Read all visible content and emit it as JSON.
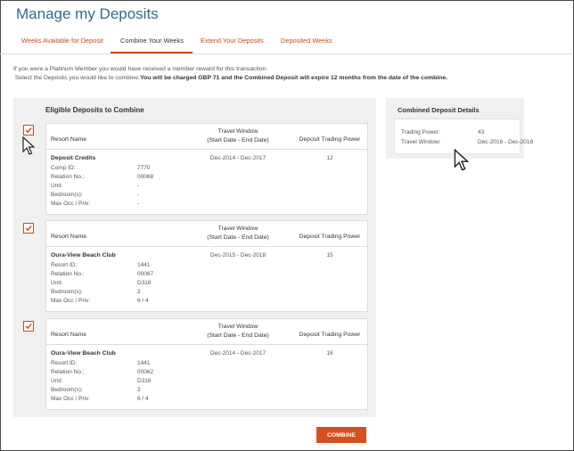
{
  "page": {
    "title": "Manage my Deposits"
  },
  "tabs": [
    {
      "label": "Weeks Available for Deposit",
      "active": false
    },
    {
      "label": "Combine Your Weeks",
      "active": true
    },
    {
      "label": "Extend Your Deposits",
      "active": false
    },
    {
      "label": "Deposited Weeks",
      "active": false
    }
  ],
  "notice": {
    "line1": "If you were a Platinum Member you would have received a member reward for this transaction.",
    "line2_prefix": "Select the Deposits you would like to combine.",
    "line2_bold": "You will be charged GBP 71 and the Combined Deposit will expire 12 months from the date of the combine."
  },
  "eligible": {
    "title": "Eligible Deposits to Combine",
    "headers": {
      "resort": "Resort Name",
      "travel_line1": "Travel Window",
      "travel_line2": "(Start Date - End Date)",
      "power": "Deposit Trading Power"
    },
    "deposits": [
      {
        "checked": true,
        "name": "Deposit Credits",
        "fields": [
          {
            "label": "Comp ID:",
            "value": "7770"
          },
          {
            "label": "Relation No.:",
            "value": "00068"
          },
          {
            "label": "Unit:",
            "value": "-"
          },
          {
            "label": "Bedroom(s):",
            "value": "-"
          },
          {
            "label": "Max Occ / Priv:",
            "value": "-"
          }
        ],
        "travel_window": "Dec-2014 - Dec-2017",
        "trading_power": "12"
      },
      {
        "checked": true,
        "name": "Oura-View Beach Club",
        "fields": [
          {
            "label": "Resort ID:",
            "value": "1441"
          },
          {
            "label": "Relation No.:",
            "value": "00067"
          },
          {
            "label": "Unit:",
            "value": "D316"
          },
          {
            "label": "Bedroom(s):",
            "value": "2"
          },
          {
            "label": "Max Occ / Priv:",
            "value": "6 / 4"
          }
        ],
        "travel_window": "Dec-2015 - Dec-2018",
        "trading_power": "15"
      },
      {
        "checked": true,
        "name": "Oura-View Beach Club",
        "fields": [
          {
            "label": "Resort ID:",
            "value": "1441"
          },
          {
            "label": "Relation No.:",
            "value": "00062"
          },
          {
            "label": "Unit:",
            "value": "D316"
          },
          {
            "label": "Bedroom(s):",
            "value": "2"
          },
          {
            "label": "Max Occ / Priv:",
            "value": "6 / 4"
          }
        ],
        "travel_window": "Dec-2014 - Dec-2017",
        "trading_power": "16"
      }
    ]
  },
  "combined": {
    "title": "Combined Deposit Details",
    "trading_power_label": "Trading Power:",
    "trading_power_value": "43",
    "travel_window_label": "Travel Window:",
    "travel_window_value": "Dec-2016 - Dec-2018"
  },
  "actions": {
    "combine_label": "COMBINE"
  },
  "colors": {
    "accent": "#c94b1c",
    "button": "#d4501e",
    "title": "#2f6d8c",
    "panel": "#f0f0f0"
  },
  "icons": {
    "checkbox": "check-icon",
    "pointer": "mouse-pointer-icon"
  }
}
